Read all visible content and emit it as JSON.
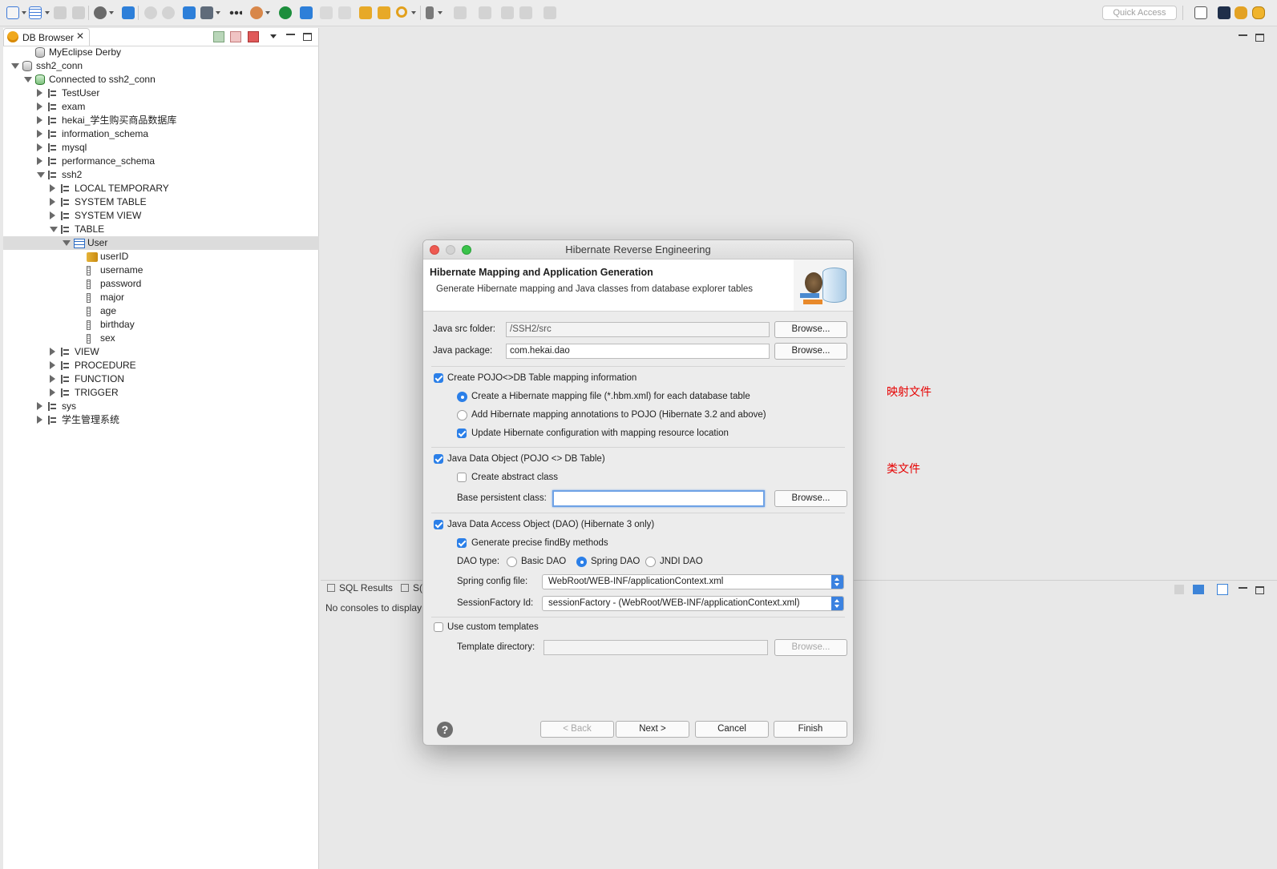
{
  "toolbar": {
    "quick_access_placeholder": "Quick Access"
  },
  "db_browser": {
    "tab_label": "DB Browser",
    "close_glyph": "✕",
    "tree": [
      {
        "label": "MyEclipse Derby",
        "level": 1,
        "icon": "database-icon",
        "toggle": "none"
      },
      {
        "label": "ssh2_conn",
        "level": 0,
        "icon": "database-icon",
        "toggle": "expanded"
      },
      {
        "label": "Connected to ssh2_conn",
        "level": 1,
        "icon": "connection-icon",
        "toggle": "expanded"
      },
      {
        "label": "TestUser",
        "level": 2,
        "icon": "schema-icon",
        "toggle": "collapsed"
      },
      {
        "label": "exam",
        "level": 2,
        "icon": "schema-icon",
        "toggle": "collapsed"
      },
      {
        "label": "hekai_学生购买商品数据库",
        "level": 2,
        "icon": "schema-icon",
        "toggle": "collapsed"
      },
      {
        "label": "information_schema",
        "level": 2,
        "icon": "schema-icon",
        "toggle": "collapsed"
      },
      {
        "label": "mysql",
        "level": 2,
        "icon": "schema-icon",
        "toggle": "collapsed"
      },
      {
        "label": "performance_schema",
        "level": 2,
        "icon": "schema-icon",
        "toggle": "collapsed"
      },
      {
        "label": "ssh2",
        "level": 2,
        "icon": "schema-icon",
        "toggle": "expanded"
      },
      {
        "label": "LOCAL TEMPORARY",
        "level": 3,
        "icon": "schema-icon",
        "toggle": "collapsed"
      },
      {
        "label": "SYSTEM TABLE",
        "level": 3,
        "icon": "schema-icon",
        "toggle": "collapsed"
      },
      {
        "label": "SYSTEM VIEW",
        "level": 3,
        "icon": "schema-icon",
        "toggle": "collapsed"
      },
      {
        "label": "TABLE",
        "level": 3,
        "icon": "schema-icon",
        "toggle": "expanded"
      },
      {
        "label": "User",
        "level": 4,
        "icon": "table-icon",
        "toggle": "expanded",
        "selected": true
      },
      {
        "label": "userID",
        "level": 5,
        "icon": "primary-key-icon",
        "toggle": "none"
      },
      {
        "label": "username",
        "level": 5,
        "icon": "column-icon",
        "toggle": "none"
      },
      {
        "label": "password",
        "level": 5,
        "icon": "column-icon",
        "toggle": "none"
      },
      {
        "label": "major",
        "level": 5,
        "icon": "column-icon",
        "toggle": "none"
      },
      {
        "label": "age",
        "level": 5,
        "icon": "column-icon",
        "toggle": "none"
      },
      {
        "label": "birthday",
        "level": 5,
        "icon": "column-icon",
        "toggle": "none"
      },
      {
        "label": "sex",
        "level": 5,
        "icon": "column-icon",
        "toggle": "none"
      },
      {
        "label": "VIEW",
        "level": 3,
        "icon": "schema-icon",
        "toggle": "collapsed"
      },
      {
        "label": "PROCEDURE",
        "level": 3,
        "icon": "schema-icon",
        "toggle": "collapsed"
      },
      {
        "label": "FUNCTION",
        "level": 3,
        "icon": "schema-icon",
        "toggle": "collapsed"
      },
      {
        "label": "TRIGGER",
        "level": 3,
        "icon": "schema-icon",
        "toggle": "collapsed"
      },
      {
        "label": "sys",
        "level": 2,
        "icon": "schema-icon",
        "toggle": "collapsed"
      },
      {
        "label": "学生管理系统",
        "level": 2,
        "icon": "schema-icon",
        "toggle": "collapsed"
      }
    ]
  },
  "console": {
    "tab1_label": "SQL Results",
    "tab2_label": "S(",
    "message": "No consoles to display a"
  },
  "annotations": {
    "mapping_file": "映射文件",
    "class_file": "类文件",
    "color": "#e60000"
  },
  "dialog": {
    "title": "Hibernate Reverse Engineering",
    "banner_title": "Hibernate Mapping and Application Generation",
    "banner_desc": "Generate Hibernate mapping and Java classes from database explorer tables",
    "src_folder_label": "Java src folder:",
    "src_folder_value": "/SSH2/src",
    "package_label": "Java package:",
    "package_value": "com.hekai.dao",
    "browse_label": "Browse...",
    "create_pojo_label": "Create POJO<>DB Table mapping information",
    "create_pojo_checked": true,
    "radio_hbm_label": "Create a Hibernate mapping file (*.hbm.xml) for each database table",
    "radio_hbm_selected": true,
    "radio_annotations_label": "Add Hibernate mapping annotations to POJO (Hibernate 3.2 and above)",
    "update_config_label": "Update Hibernate configuration with mapping resource location",
    "update_config_checked": true,
    "java_data_object_label": "Java Data Object (POJO <> DB Table)",
    "java_data_object_checked": true,
    "abstract_class_label": "Create abstract class",
    "abstract_class_checked": false,
    "base_class_label": "Base persistent class:",
    "base_class_value": "",
    "dao_label": "Java Data Access Object (DAO) (Hibernate 3 only)",
    "dao_checked": true,
    "findby_label": "Generate precise findBy methods",
    "findby_checked": true,
    "dao_type_label": "DAO type:",
    "dao_basic_label": "Basic DAO",
    "dao_spring_label": "Spring DAO",
    "dao_jndi_label": "JNDI DAO",
    "dao_selected": "Spring DAO",
    "spring_config_label": "Spring config file:",
    "spring_config_value": "WebRoot/WEB-INF/applicationContext.xml",
    "session_factory_label": "SessionFactory Id:",
    "session_factory_value": "sessionFactory - (WebRoot/WEB-INF/applicationContext.xml)",
    "custom_templates_label": "Use custom templates",
    "custom_templates_checked": false,
    "template_dir_label": "Template directory:",
    "template_dir_value": "",
    "help_glyph": "?",
    "back_label": "< Back",
    "next_label": "Next >",
    "cancel_label": "Cancel",
    "finish_label": "Finish"
  }
}
